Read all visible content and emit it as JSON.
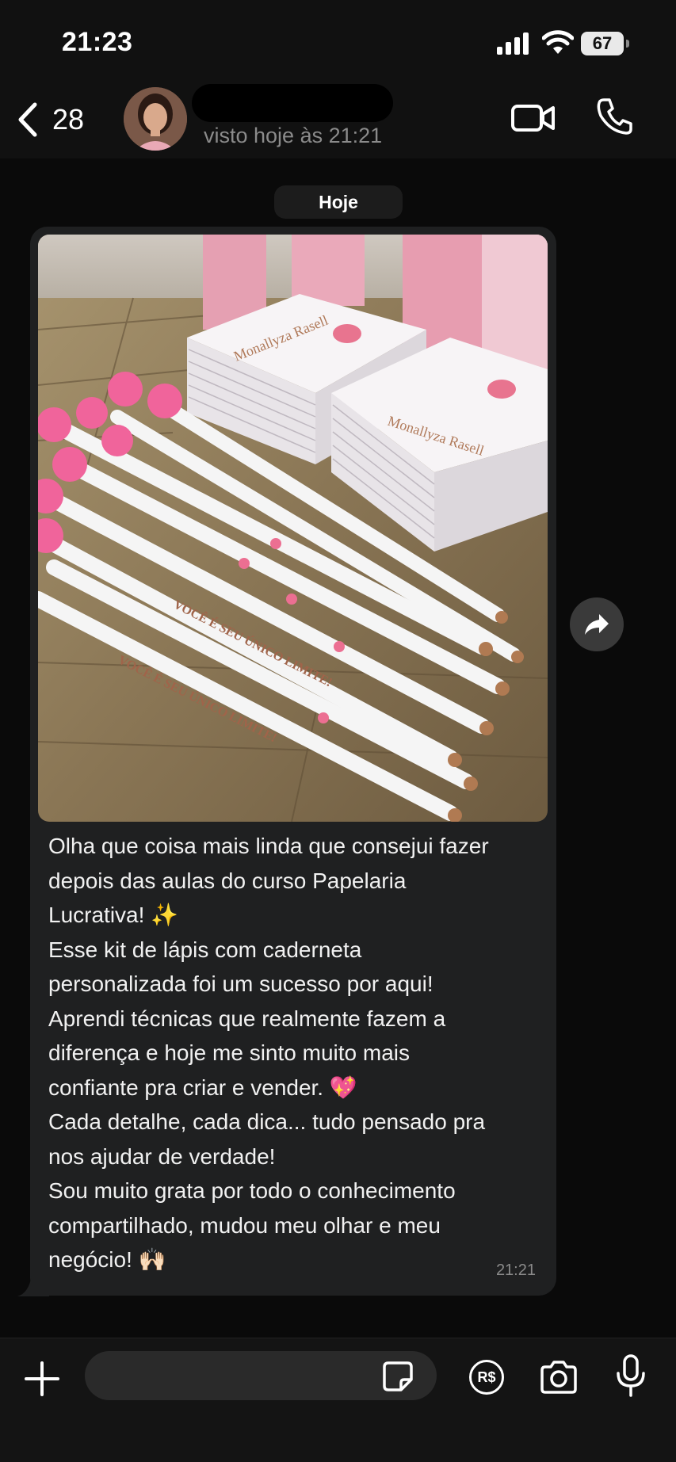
{
  "status_bar": {
    "time": "21:23",
    "battery": "67",
    "icons": [
      "signal-icon",
      "wifi-icon",
      "battery-icon"
    ]
  },
  "header": {
    "back_count": "28",
    "last_seen": "visto hoje às 21:21",
    "icons": [
      "back-chevron-icon",
      "video-call-icon",
      "phone-icon"
    ]
  },
  "chat": {
    "date_chip": "Hoje",
    "message": {
      "text": "Olha que coisa mais linda que consejui fazer\ndepois das aulas do curso Papelaria\nLucrativa! ✨\nEsse kit de lápis com caderneta\npersonalizada foi um sucesso por aqui!\nAprendi técnicas que realmente fazem a\ndiferença e hoje me sinto muito mais\nconfiante pra criar e vender. 💖\nCada detalhe, cada dica... tudo pensado pra\nnos ajudar de verdade!\nSou muito grata por todo o conhecimento\ncompartilhado, mudou meu olhar e meu\nnegócio! 🙌🏻",
      "time": "21:21",
      "photo": {
        "notebook_brand": "Monallyza Rasell",
        "pencil_slogan": "VOCÊ É SEU ÚNICO LIMITE!"
      }
    }
  },
  "input_bar": {
    "placeholder": "",
    "pay_label": "R$",
    "icons": [
      "plus-icon",
      "sticker-icon",
      "camera-icon",
      "microphone-icon"
    ]
  },
  "colors": {
    "background": "#0b0b0b",
    "bubble": "#1f2021",
    "secondary_text": "#8b8b8b",
    "pencil_pink": "#f0649b",
    "bag_pink": "#e8a3b4"
  }
}
